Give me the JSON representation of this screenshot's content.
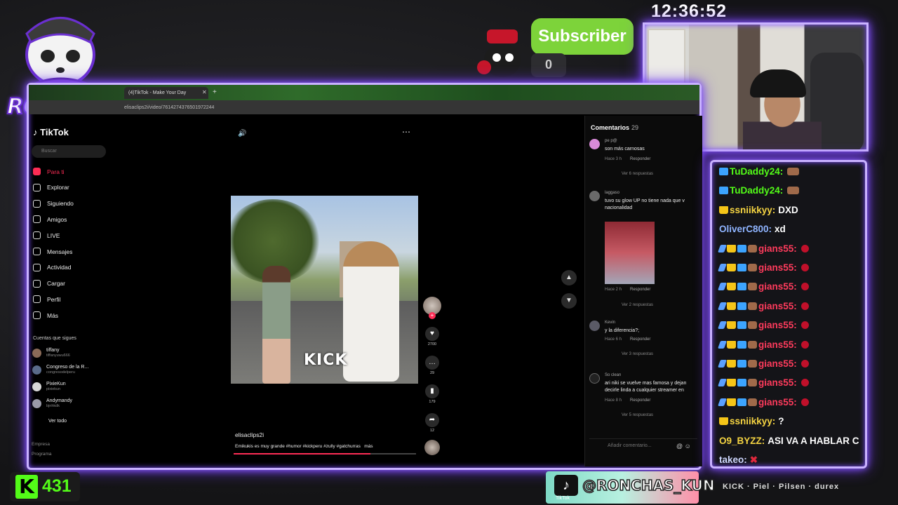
{
  "clock": "12:36:52",
  "logo_text": "RONCHAS",
  "subscriber": {
    "label": "Subscriber",
    "count": "0"
  },
  "browser": {
    "tab_title": "(4)TikTok - Make Your Day",
    "url": "elisaclips2i/video/7614274376501972244"
  },
  "tiktok": {
    "logo": "TikTok",
    "search_placeholder": "Buscar",
    "nav": [
      {
        "label": "Para ti",
        "active": true
      },
      {
        "label": "Explorar"
      },
      {
        "label": "Siguiendo"
      },
      {
        "label": "Amigos"
      },
      {
        "label": "LIVE"
      },
      {
        "label": "Mensajes"
      },
      {
        "label": "Actividad"
      },
      {
        "label": "Cargar"
      },
      {
        "label": "Perfil"
      },
      {
        "label": "Más"
      }
    ],
    "following_title": "Cuentas que sigues",
    "following": [
      {
        "name": "tiffany",
        "handle": "tiffanyuwu666"
      },
      {
        "name": "Congreso de la R...",
        "handle": "congresodelperu"
      },
      {
        "name": "PixieKun",
        "handle": "pixiekun"
      },
      {
        "name": "Andymandy",
        "handle": "bjnhkdk"
      }
    ],
    "see_all": "Ver todo",
    "footer": [
      "Empresa",
      "Programa"
    ],
    "video": {
      "watermark": "KICK",
      "username": "elisaclips2i",
      "description": "Emikukis es muy grande #humor #kickperu #zully #gatchurras",
      "more": "más",
      "progress_fraction": 0.75
    },
    "actions": {
      "likes": "2700",
      "comments": "29",
      "saves": "179",
      "shares": "12"
    },
    "comments": {
      "title": "Comentarios",
      "count": "29",
      "input_placeholder": "Añadir comentario...",
      "items": [
        {
          "user": "pe p@",
          "text": "son más carnosas",
          "meta": "Hace 3 h",
          "reply": "Responder",
          "replies": "Ver 6 respuestas"
        },
        {
          "user": "laggaso",
          "text": "tuvo su glow UP no tiene nada que v",
          "text2": "nacionalidad",
          "meta": "Hace 2 h",
          "reply": "Responder",
          "replies": "Ver 2 respuestas"
        },
        {
          "user": "Kevin",
          "text": "y la diferencia?;",
          "meta": "Hace 6 h",
          "reply": "Responder",
          "replies": "Ver 3 respuestas"
        },
        {
          "user": "So clean",
          "text": "ari niki se vuelve mas famosa y dejan",
          "text2": "decirle linda a cualquier streamer en",
          "meta": "Hace 8 h",
          "reply": "Responder",
          "replies": "Ver 5 respuestas"
        }
      ]
    }
  },
  "chat": [
    {
      "user": "TuDaddy24:",
      "text": "",
      "color": "#53fc18",
      "badges": [
        "blue"
      ],
      "emote": true
    },
    {
      "user": "TuDaddy24:",
      "text": "",
      "color": "#53fc18",
      "badges": [
        "blue"
      ],
      "emote": true
    },
    {
      "user": "ssniikkyy:",
      "text": "DXD",
      "color": "#f5d442",
      "badges": [
        "crown"
      ]
    },
    {
      "user": "OliverC800:",
      "text": "xd",
      "color": "#8fb4ff",
      "badges": []
    },
    {
      "user": "gians55:",
      "text": "",
      "color": "#ff3b5c",
      "badges": [
        "sword",
        "crown",
        "blue",
        "emote"
      ],
      "red": true
    },
    {
      "user": "gians55:",
      "text": "",
      "color": "#ff3b5c",
      "badges": [
        "sword",
        "crown",
        "blue",
        "emote"
      ],
      "red": true
    },
    {
      "user": "gians55:",
      "text": "",
      "color": "#ff3b5c",
      "badges": [
        "sword",
        "crown",
        "blue",
        "emote"
      ],
      "red": true
    },
    {
      "user": "gians55:",
      "text": "",
      "color": "#ff3b5c",
      "badges": [
        "sword",
        "crown",
        "blue",
        "emote"
      ],
      "red": true
    },
    {
      "user": "gians55:",
      "text": "",
      "color": "#ff3b5c",
      "badges": [
        "sword",
        "crown",
        "blue",
        "emote"
      ],
      "red": true
    },
    {
      "user": "gians55:",
      "text": "",
      "color": "#ff3b5c",
      "badges": [
        "sword",
        "crown",
        "blue",
        "emote"
      ],
      "red": true
    },
    {
      "user": "gians55:",
      "text": "",
      "color": "#ff3b5c",
      "badges": [
        "sword",
        "crown",
        "blue",
        "emote"
      ],
      "red": true
    },
    {
      "user": "gians55:",
      "text": "",
      "color": "#ff3b5c",
      "badges": [
        "sword",
        "crown",
        "blue",
        "emote"
      ],
      "red": true
    },
    {
      "user": "gians55:",
      "text": "",
      "color": "#ff3b5c",
      "badges": [
        "sword",
        "crown",
        "blue",
        "emote"
      ],
      "red": true
    },
    {
      "user": "ssniikkyy:",
      "text": "?",
      "color": "#f5d442",
      "badges": [
        "crown"
      ]
    },
    {
      "user": "O9_BYZZ:",
      "text": "ASI VA A HABLAR C",
      "color": "#f5d442",
      "badges": []
    },
    {
      "user": "takeo:",
      "text": "✖",
      "color": "#cfd8ff",
      "badges": []
    }
  ],
  "kick_followers": "431",
  "tiktok_banner": {
    "handle": "@RONCHAS_KUN",
    "small": "TikTok"
  },
  "sponsors": "KICK · Piel · Pilsen · durex",
  "colors": {
    "neon": "#c9b2ff",
    "kick_green": "#53fc18",
    "tiktok_red": "#fe2c55",
    "subscriber_green": "#7dd33a"
  }
}
